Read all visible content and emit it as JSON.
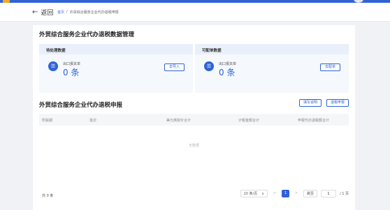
{
  "header": {
    "back_label": "返回",
    "breadcrumb": {
      "home": "首页",
      "sep": "/",
      "current": "外贸综合服务企业代办退税申报"
    }
  },
  "data_section": {
    "title": "外贸综合服务企业代办退税数据管理",
    "panels": [
      {
        "title": "待处理数据",
        "label": "出口报关单",
        "value": "0 条",
        "button": "去导入"
      },
      {
        "title": "可配单数据",
        "label": "出口报关单",
        "value": "0 条",
        "button": "去配单"
      }
    ]
  },
  "declare_section": {
    "title": "外贸综合服务企业代办退税申报",
    "buttons": [
      "填写说明",
      "退税申报"
    ],
    "columns": [
      "所属期",
      "批次",
      "美元离岸价合计",
      "计税金额合计",
      "申报代办退税额合计"
    ],
    "empty_text": "无数据"
  },
  "pagination": {
    "total": "共 0 条",
    "page_size": "10 条/页",
    "size_arrow": "∨",
    "prev": "<",
    "current_page": "1",
    "next": ">",
    "jump_label": "跳至",
    "jump_value": "1",
    "page_total": "/ 1 页"
  }
}
